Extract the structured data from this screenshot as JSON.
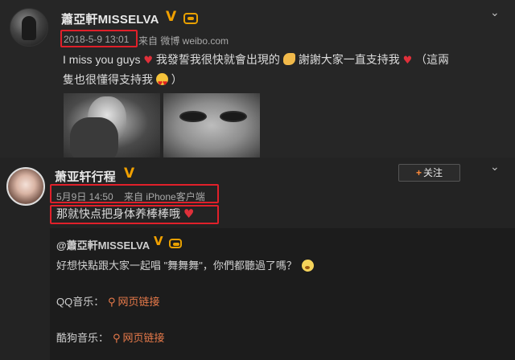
{
  "post": {
    "author": "蕭亞軒MISSELVA",
    "timestamp": "2018-5-9 13:01",
    "source": "来自 微博 weibo.com",
    "text_line1_a": "I miss you guys",
    "text_line1_b": "我發誓我很快就會出現的",
    "text_line1_c": "謝謝大家一直支持我",
    "text_line1_d": "（這兩",
    "text_line2_a": "隻也很懂得支持我",
    "text_line2_b": "）"
  },
  "reply": {
    "author": "萧亚轩行程",
    "timestamp": "5月9日 14:50",
    "source": "来自 iPhone客户端",
    "text": "那就快点把身体养棒棒哦",
    "follow_label": "关注"
  },
  "repost": {
    "author": "@蕭亞軒MISSELVA",
    "text": "好想快點跟大家一起唱 \"舞舞舞\"，你們都聽過了嗎？",
    "qq_label": "QQ音乐：",
    "qq_link": "网页链接",
    "kugou_label": "酷狗音乐：",
    "kugou_link": "网页链接"
  },
  "icons": {
    "verified": "verified-v-icon",
    "vip": "vip-crown-icon",
    "menu": "chevron-down-icon",
    "heart": "heart-icon",
    "link": "link-icon"
  },
  "colors": {
    "highlight": "#e0202a",
    "verified": "#f0a000",
    "link": "#e87a4a"
  }
}
